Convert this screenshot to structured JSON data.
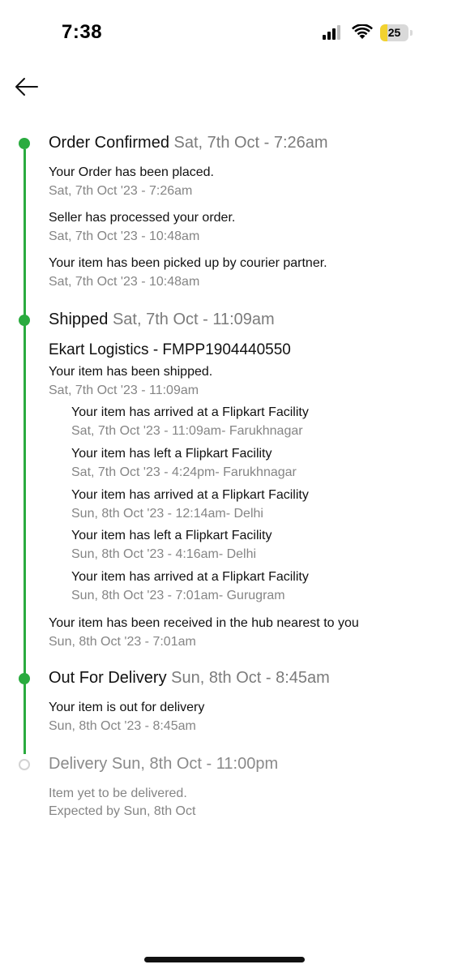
{
  "status_bar": {
    "time": "7:38",
    "battery": "25",
    "battery_level": 0.25
  },
  "stages": {
    "confirmed": {
      "title": "Order Confirmed",
      "when": "Sat, 7th Oct - 7:26am",
      "events": [
        {
          "text": "Your Order has been placed.",
          "date": "Sat, 7th Oct '23 - 7:26am"
        },
        {
          "text": "Seller has processed your order.",
          "date": "Sat, 7th Oct '23 - 10:48am"
        },
        {
          "text": "Your item has been picked up by courier partner.",
          "date": "Sat, 7th Oct '23 - 10:48am"
        }
      ]
    },
    "shipped": {
      "title": "Shipped",
      "when": "Sat, 7th Oct - 11:09am",
      "courier": "Ekart Logistics - FMPP1904440550",
      "shipped_event": {
        "text": "Your item has been shipped.",
        "date": "Sat, 7th Oct '23 - 11:09am"
      },
      "facility_events": [
        {
          "text": "Your item has arrived at a Flipkart Facility",
          "date": "Sat, 7th Oct '23 - 11:09am- Farukhnagar"
        },
        {
          "text": "Your item has left a Flipkart Facility",
          "date": "Sat, 7th Oct '23 - 4:24pm- Farukhnagar"
        },
        {
          "text": "Your item has arrived at a Flipkart Facility",
          "date": "Sun, 8th Oct '23 - 12:14am- Delhi"
        },
        {
          "text": "Your item has left a Flipkart Facility",
          "date": "Sun, 8th Oct '23 - 4:16am- Delhi"
        },
        {
          "text": "Your item has arrived at a Flipkart Facility",
          "date": "Sun, 8th Oct '23 - 7:01am- Gurugram"
        }
      ],
      "hub_event": {
        "text": "Your item has been received in the hub nearest to you",
        "date": "Sun, 8th Oct '23 - 7:01am"
      }
    },
    "out_for_delivery": {
      "title": "Out For Delivery",
      "when": "Sun, 8th Oct - 8:45am",
      "events": [
        {
          "text": "Your item is out for delivery",
          "date": "Sun, 8th Oct '23 - 8:45am"
        }
      ]
    },
    "delivery": {
      "title": "Delivery",
      "when": "Sun, 8th Oct - 11:00pm",
      "note_line1": "Item yet to be delivered.",
      "note_line2": "Expected by Sun, 8th Oct"
    }
  },
  "colors": {
    "progress": "#2aab3f",
    "muted": "#858585",
    "pending_dot": "#d2d2d2",
    "battery": "#f2d230"
  }
}
